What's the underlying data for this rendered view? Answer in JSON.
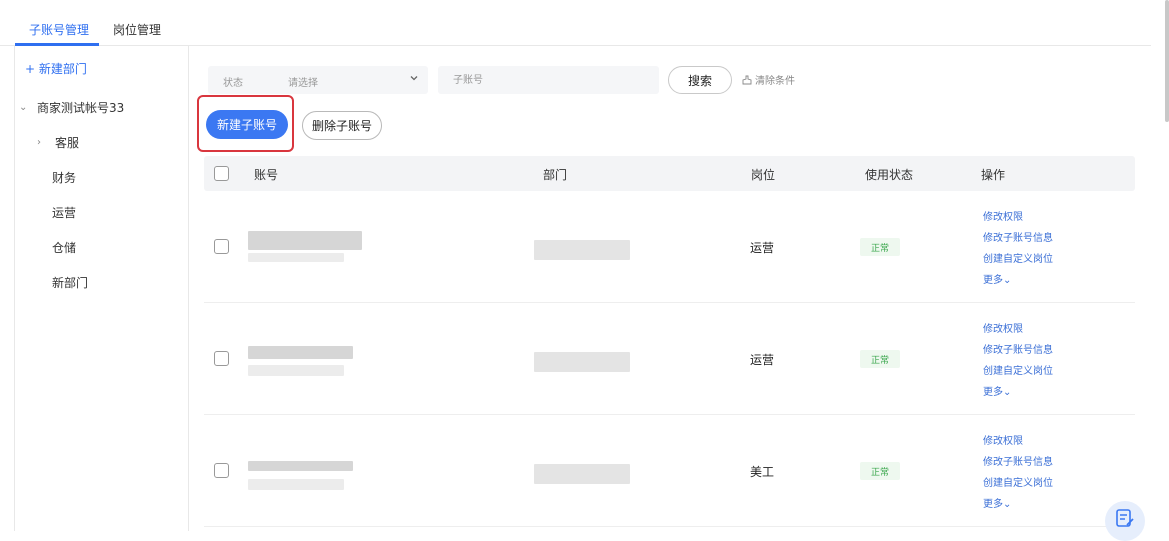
{
  "tabs": [
    {
      "label": "子账号管理",
      "active": true
    },
    {
      "label": "岗位管理",
      "active": false
    }
  ],
  "sidebar": {
    "new_dept_label": "+ 新建部门",
    "root": {
      "label": "商家测试帐号33",
      "expanded": true
    },
    "items": [
      {
        "label": "客服",
        "has_children": true
      },
      {
        "label": "财务"
      },
      {
        "label": "运营"
      },
      {
        "label": "仓储"
      },
      {
        "label": "新部门"
      }
    ]
  },
  "filters": {
    "status_label": "状态",
    "status_placeholder": "请选择",
    "account_placeholder": "子账号",
    "search_label": "搜索",
    "clear_label": "清除条件"
  },
  "actions": {
    "new_account_label": "新建子账号",
    "delete_account_label": "删除子账号"
  },
  "table": {
    "columns": [
      "账号",
      "部门",
      "岗位",
      "使用状态",
      "操作"
    ],
    "rows": [
      {
        "position": "运营",
        "status": "正常"
      },
      {
        "position": "运营",
        "status": "正常"
      },
      {
        "position": "美工",
        "status": "正常"
      }
    ],
    "operations": [
      "修改权限",
      "修改子账号信息",
      "创建自定义岗位",
      "更多⌄"
    ]
  },
  "colors": {
    "accent": "#3b78f2",
    "status_green": "#3aa64c",
    "highlight_red": "#d9363e",
    "link_blue": "#3b6fd6"
  },
  "icons": [
    "chevron-down-icon",
    "chevron-right-icon",
    "broom-icon",
    "edit-note-icon"
  ]
}
